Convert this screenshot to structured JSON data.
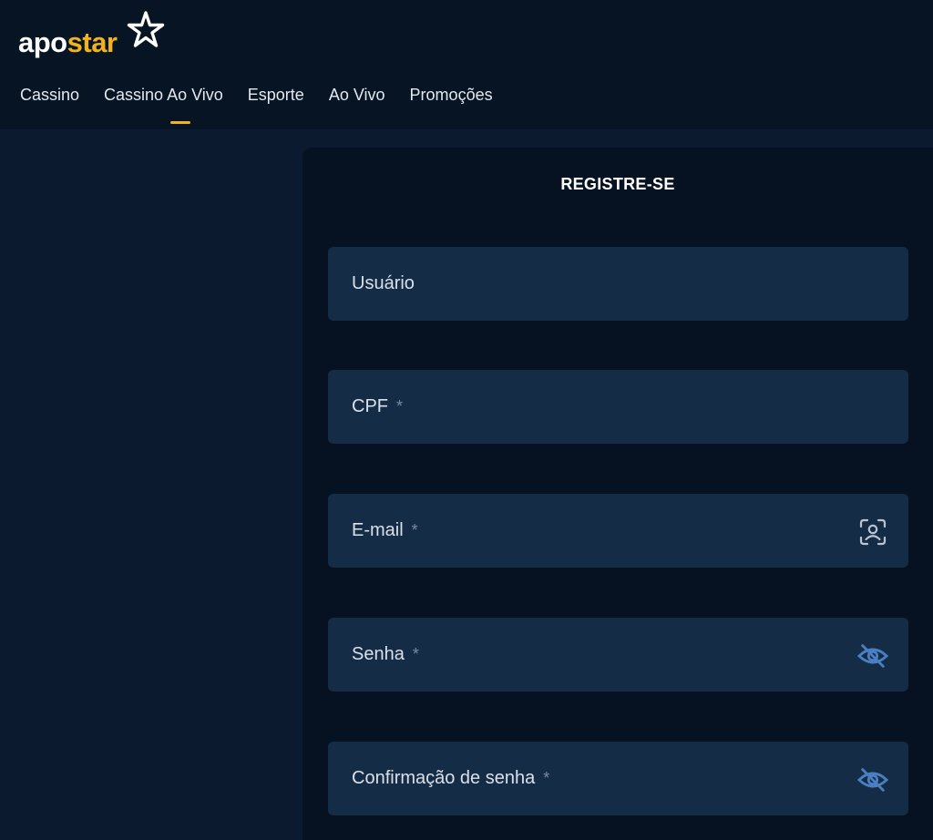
{
  "brand": {
    "part1": "apo",
    "part2": "star"
  },
  "nav": {
    "items": [
      "Cassino",
      "Cassino Ao Vivo",
      "Esporte",
      "Ao Vivo",
      "Promoções"
    ]
  },
  "register": {
    "title": "REGISTRE-SE",
    "fields": [
      {
        "label": "Usuário",
        "required": "",
        "icon": ""
      },
      {
        "label": "CPF",
        "required": "*",
        "icon": ""
      },
      {
        "label": "E-mail",
        "required": "*",
        "icon": "contact-scan-icon"
      },
      {
        "label": "Senha",
        "required": "*",
        "icon": "eye-off-icon"
      },
      {
        "label": "Confirmação de senha",
        "required": "*",
        "icon": "eye-off-icon"
      }
    ]
  },
  "colors": {
    "accent": "#f2b31a",
    "header_bg": "#071424",
    "page_bg": "#0b1a2e",
    "panel_bg": "#061221",
    "field_bg": "#152c47",
    "icon_blue": "#4a7fc1"
  }
}
